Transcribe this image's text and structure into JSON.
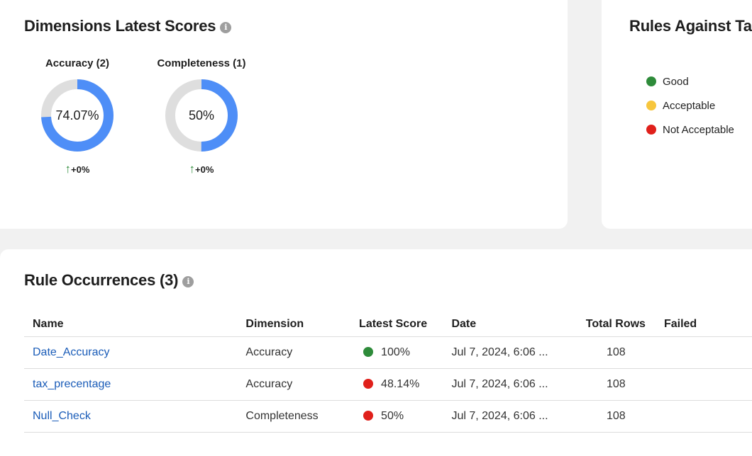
{
  "dimensions": {
    "title": "Dimensions Latest Scores",
    "info_icon": "info-circle-icon",
    "items": [
      {
        "label": "Accuracy (2)",
        "value_text": "74.07%",
        "value": 74.07,
        "trend_arrow": "↑",
        "trend": "+0%",
        "ring_color": "#4e8ef7",
        "track_color": "#dedede",
        "trend_color": "#2e8b3a"
      },
      {
        "label": "Completeness (1)",
        "value_text": "50%",
        "value": 50,
        "trend_arrow": "↑",
        "trend": "+0%",
        "ring_color": "#4e8ef7",
        "track_color": "#dedede",
        "trend_color": "#2e8b3a"
      }
    ]
  },
  "rules_against": {
    "title": "Rules Against Ta",
    "legend": [
      {
        "label": "Good",
        "color": "#2e8b3a"
      },
      {
        "label": "Acceptable",
        "color": "#f7c63d"
      },
      {
        "label": "Not Acceptable",
        "color": "#e0201b"
      }
    ]
  },
  "occurrences": {
    "title": "Rule Occurrences (3)",
    "info_icon": "info-circle-icon",
    "columns": [
      "Name",
      "Dimension",
      "Latest Score",
      "Date",
      "Total Rows",
      "Failed"
    ],
    "rows": [
      {
        "name": "Date_Accuracy",
        "dimension": "Accuracy",
        "score": "100%",
        "score_color": "#2e8b3a",
        "date": "Jul 7, 2024, 6:06 ...",
        "total_rows": "108"
      },
      {
        "name": "tax_precentage",
        "dimension": "Accuracy",
        "score": "48.14%",
        "score_color": "#e0201b",
        "date": "Jul 7, 2024, 6:06 ...",
        "total_rows": "108"
      },
      {
        "name": "Null_Check",
        "dimension": "Completeness",
        "score": "50%",
        "score_color": "#e0201b",
        "date": "Jul 7, 2024, 6:06 ...",
        "total_rows": "108"
      }
    ]
  }
}
